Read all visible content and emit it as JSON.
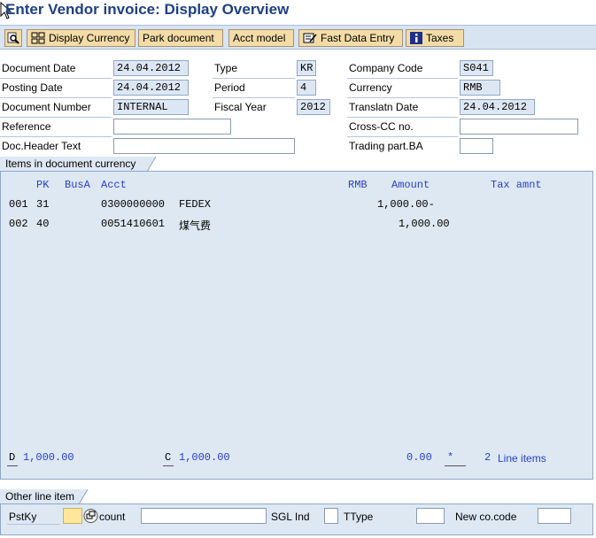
{
  "title": "Enter Vendor invoice: Display Overview",
  "toolbar": {
    "display_currency": "Display Currency",
    "park_document": "Park document",
    "acct_model": "Acct model",
    "fast_data_entry": "Fast Data Entry",
    "taxes": "Taxes"
  },
  "header": {
    "document_date": {
      "label": "Document Date",
      "value": "24.04.2012"
    },
    "posting_date": {
      "label": "Posting Date",
      "value": "24.04.2012"
    },
    "document_number": {
      "label": "Document Number",
      "value": "INTERNAL"
    },
    "reference": {
      "label": "Reference",
      "value": ""
    },
    "doc_header_text": {
      "label": "Doc.Header Text",
      "value": ""
    },
    "type": {
      "label": "Type",
      "value": "KR"
    },
    "period": {
      "label": "Period",
      "value": "4"
    },
    "fiscal_year": {
      "label": "Fiscal Year",
      "value": "2012"
    },
    "company_code": {
      "label": "Company Code",
      "value": "S041"
    },
    "currency": {
      "label": "Currency",
      "value": "RMB"
    },
    "translatn_date": {
      "label": "Translatn Date",
      "value": "24.04.2012"
    },
    "cross_cc_no": {
      "label": "Cross-CC no.",
      "value": ""
    },
    "trading_part_ba": {
      "label": "Trading part.BA",
      "value": ""
    }
  },
  "items": {
    "title": "Items in document currency",
    "columns": {
      "pk": "PK",
      "busa": "BusA",
      "acct": "Acct",
      "rmb": "RMB",
      "amount": "Amount",
      "tax_amnt": "Tax amnt"
    },
    "rows": [
      {
        "no": "001",
        "pk": "31",
        "acct": "0300000000",
        "name": "FEDEX",
        "amount": "1,000.00-"
      },
      {
        "no": "002",
        "pk": "40",
        "acct": "0051410601",
        "name": "煤气费",
        "amount": "1,000.00"
      }
    ],
    "footer": {
      "d_label": "D",
      "d_value": "1,000.00",
      "c_label": "C",
      "c_value": "1,000.00",
      "balance": "0.00",
      "balance_indicator": "*",
      "line_count": "2",
      "line_items_label": "Line items"
    }
  },
  "other_line_item": {
    "title": "Other line item",
    "pstky_label": "PstKy",
    "pstky_value": "",
    "account_label": "count",
    "account_value": "",
    "sgl_ind_label": "SGL Ind",
    "sgl_ind_value": "",
    "ttype_label": "TType",
    "ttype_value": "",
    "new_co_code_label": "New co.code",
    "new_co_code_value": ""
  }
}
